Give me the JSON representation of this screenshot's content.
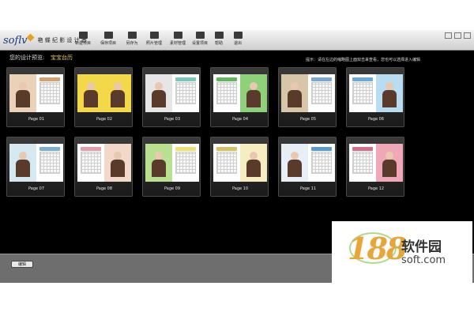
{
  "app": {
    "logo_text": "soflv",
    "logo_subtitle": "艳  蝶  纪 影 设 计 者"
  },
  "toolbar": {
    "buttons": [
      {
        "label": "新建项目",
        "icon": "new-project-icon"
      },
      {
        "label": "保存项目",
        "icon": "save-icon"
      },
      {
        "label": "另存为",
        "icon": "save-as-icon"
      },
      {
        "label": "照片管理",
        "icon": "photo-manage-icon"
      },
      {
        "label": "素材管理",
        "icon": "material-icon"
      },
      {
        "label": "设置项目",
        "icon": "folder-icon"
      },
      {
        "label": "帮助",
        "icon": "help-icon"
      },
      {
        "label": "退出",
        "icon": "exit-icon"
      }
    ]
  },
  "info": {
    "preview_label": "您的设计预览:",
    "preview_title": "宝宝台历",
    "hint": "提示：请在左边的缩略图上面双击来查看，您也可以选择进入编辑"
  },
  "pages": [
    {
      "label": "Page 01",
      "left": "photo",
      "right": "calendar",
      "photo_color": "#e9d2b8",
      "accent": "#d8a070"
    },
    {
      "label": "Page 02",
      "left": "photo",
      "right": "photo",
      "photo_color": "#f3d84a",
      "accent": "#e7b52a"
    },
    {
      "label": "Page 03",
      "left": "photo",
      "right": "calendar",
      "photo_color": "#e6e6e6",
      "accent": "#7cc6c0"
    },
    {
      "label": "Page 04",
      "left": "calendar",
      "right": "photo",
      "photo_color": "#8fd07a",
      "accent": "#5fb85a"
    },
    {
      "label": "Page 05",
      "left": "photo",
      "right": "calendar",
      "photo_color": "#d8c6a8",
      "accent": "#7aa6d8"
    },
    {
      "label": "Page 06",
      "left": "calendar",
      "right": "photo",
      "photo_color": "#b8dcf0",
      "accent": "#6aa8e0"
    },
    {
      "label": "Page 07",
      "left": "photo",
      "right": "calendar",
      "photo_color": "#d6e8f0",
      "accent": "#7ab0d8"
    },
    {
      "label": "Page 08",
      "left": "calendar",
      "right": "photo",
      "photo_color": "#f2d8c8",
      "accent": "#e89aa8"
    },
    {
      "label": "Page 09",
      "left": "photo",
      "right": "calendar",
      "photo_color": "#b8e090",
      "accent": "#f0e070"
    },
    {
      "label": "Page 10",
      "left": "calendar",
      "right": "photo",
      "photo_color": "#f6eec0",
      "accent": "#d8c060"
    },
    {
      "label": "Page 11",
      "left": "photo",
      "right": "calendar",
      "photo_color": "#e8eef6",
      "accent": "#5a9ad8"
    },
    {
      "label": "Page 12",
      "left": "calendar",
      "right": "photo",
      "photo_color": "#f0a8b8",
      "accent": "#d86a8a"
    }
  ],
  "statusbar": {
    "edit_label": "编辑"
  },
  "watermark": {
    "number": "188",
    "name": "软件园",
    "url": "soft.com"
  }
}
